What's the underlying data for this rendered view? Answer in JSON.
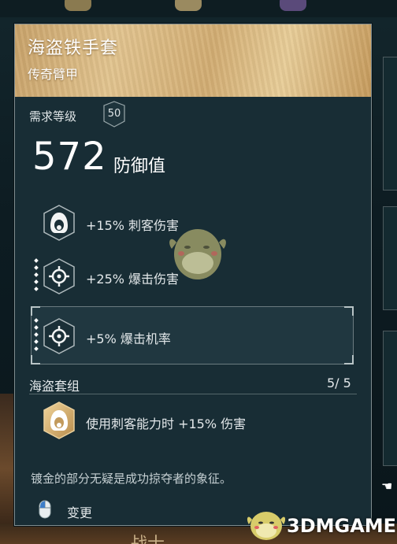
{
  "item": {
    "name": "海盗铁手套",
    "rarity_type": "传奇臂甲"
  },
  "requirement": {
    "label": "需求等级",
    "level": "50"
  },
  "defense": {
    "value": "572",
    "label": "防御值"
  },
  "perks": [
    {
      "icon": "hooded-assassin-icon",
      "text": "+15% 刺客伤害"
    },
    {
      "icon": "crosshair-icon",
      "text": "+25% 爆击伤害"
    },
    {
      "icon": "crosshair-icon",
      "text": "+5% 爆击机率"
    }
  ],
  "set": {
    "name": "海盗套组",
    "count": "5/ 5",
    "bonus_icon": "hooded-assassin-icon",
    "bonus_text": "使用刺客能力时 +15% 伤害"
  },
  "flavor_text": "镀金的部分无疑是成功掠夺者的象征。",
  "actions": {
    "change_label": "变更",
    "change_icon": "mouse-icon"
  },
  "background": {
    "bottom_text": "战士"
  },
  "watermark": {
    "site": "3DMGAME"
  },
  "colors": {
    "header_gold": "#d9b57c",
    "panel_bg": "#182d35",
    "border": "#7f8d90",
    "text": "#e3e8ea"
  }
}
